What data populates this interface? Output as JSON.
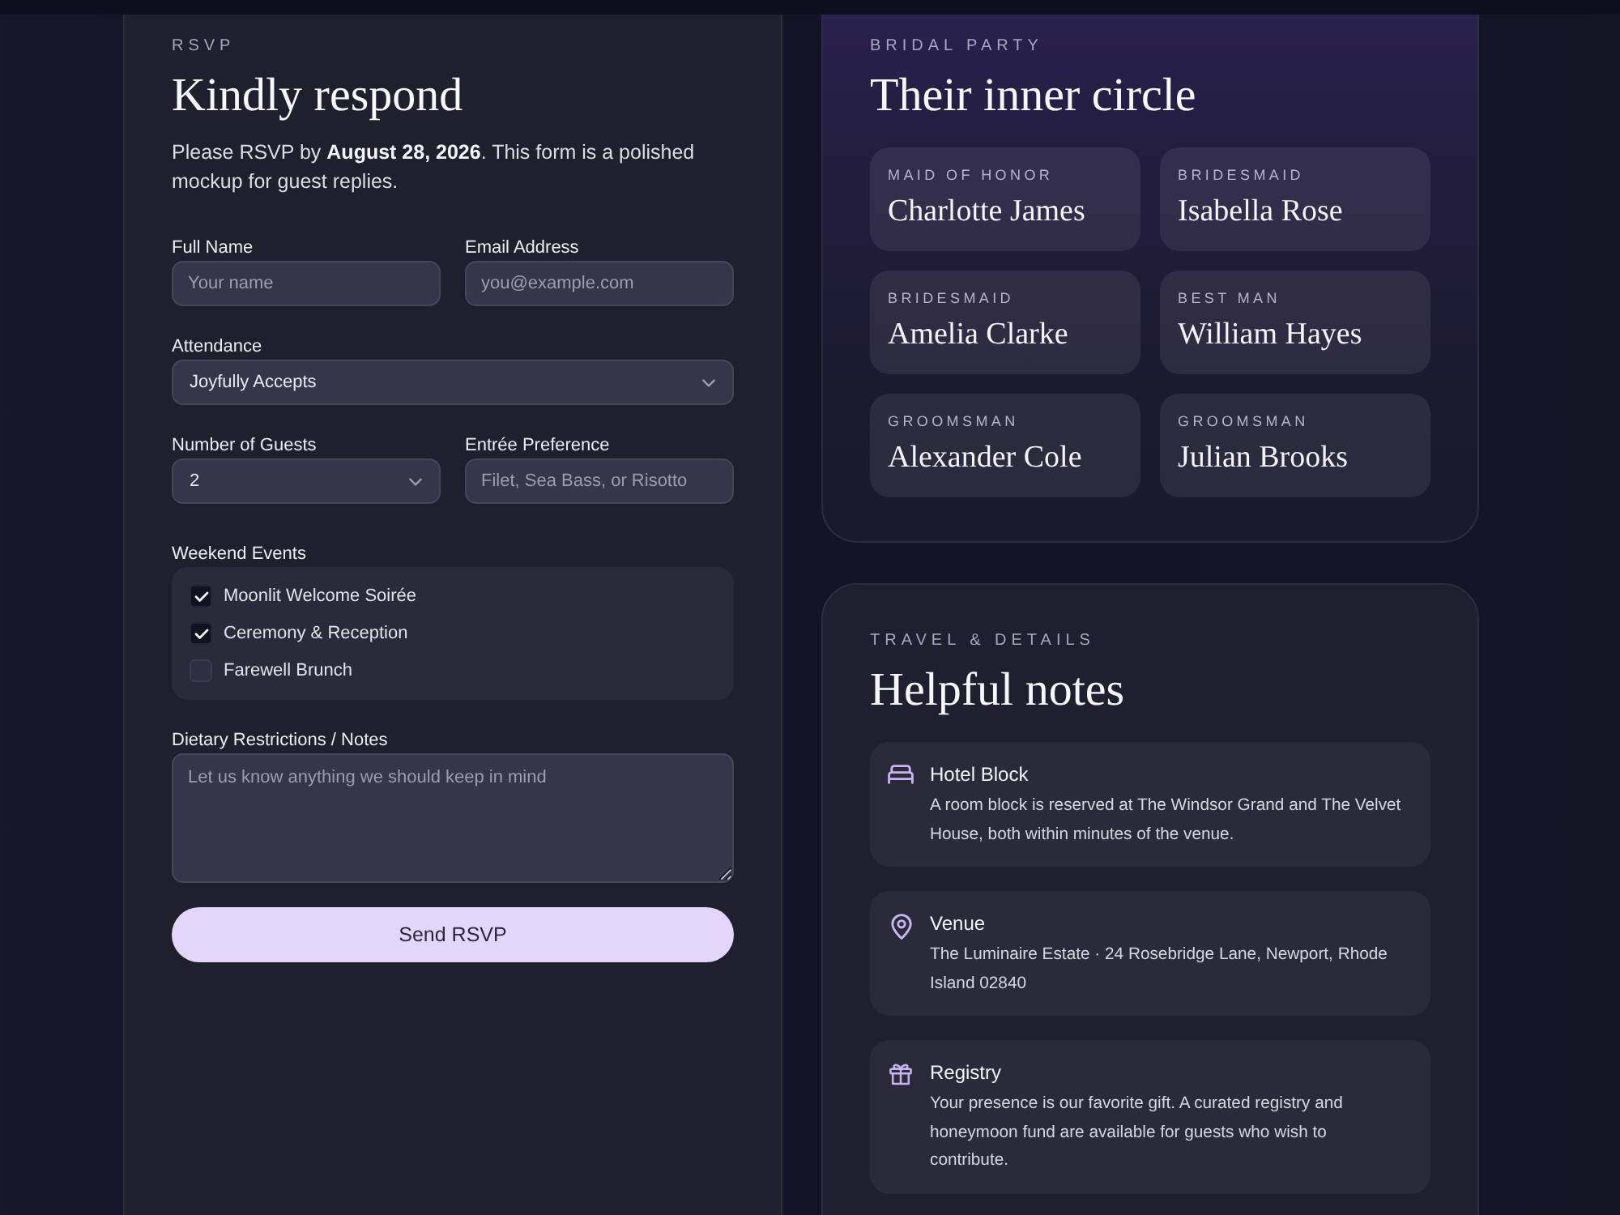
{
  "rsvp": {
    "eyebrow": "RSVP",
    "title": "Kindly respond",
    "intro": "Please RSVP by **August 28, 2026**. This form is a polished mockup for guest replies.",
    "field_rows": [
      [
        {
          "kind": "input",
          "label": "Full Name",
          "placeholder": "Your name"
        },
        {
          "kind": "input",
          "label": "Email Address",
          "placeholder": "you@example.com"
        }
      ],
      [
        {
          "kind": "select",
          "label": "Attendance",
          "value": "Joyfully Accepts"
        }
      ],
      [
        {
          "kind": "select",
          "label": "Number of Guests",
          "value": "2"
        },
        {
          "kind": "input",
          "label": "Entrée Preference",
          "placeholder": "Filet, Sea Bass, or Risotto"
        }
      ]
    ],
    "events": {
      "label": "Weekend Events",
      "items": [
        {
          "label": "Moonlit Welcome Soirée",
          "checked": true
        },
        {
          "label": "Ceremony & Reception",
          "checked": true
        },
        {
          "label": "Farewell Brunch",
          "checked": false
        }
      ]
    },
    "notes": {
      "label": "Dietary Restrictions / Notes",
      "placeholder": "Let us know anything we should keep in mind"
    },
    "submit": "Send RSVP"
  },
  "bridal_party": {
    "eyebrow": "BRIDAL PARTY",
    "title": "Their inner circle",
    "members": [
      {
        "role": "MAID OF HONOR",
        "name": "Charlotte James"
      },
      {
        "role": "BRIDESMAID",
        "name": "Isabella Rose"
      },
      {
        "role": "BRIDESMAID",
        "name": "Amelia Clarke"
      },
      {
        "role": "BEST MAN",
        "name": "William Hayes"
      },
      {
        "role": "GROOMSMAN",
        "name": "Alexander Cole"
      },
      {
        "role": "GROOMSMAN",
        "name": "Julian Brooks"
      }
    ]
  },
  "travel": {
    "eyebrow": "TRAVEL & DETAILS",
    "title": "Helpful notes",
    "notes": [
      {
        "kind": "hotel",
        "title": "Hotel Block",
        "text": "A room block is reserved at The Windsor Grand and The Velvet House, both within minutes of the venue."
      },
      {
        "kind": "venue",
        "title": "Venue",
        "text": "The Luminaire Estate · 24 Rosebridge Lane, Newport, Rhode Island 02840"
      },
      {
        "kind": "registry",
        "title": "Registry",
        "text": "Your presence is our favorite gift. A curated registry and honeymoon fund are available for guests who wish to contribute."
      }
    ]
  }
}
